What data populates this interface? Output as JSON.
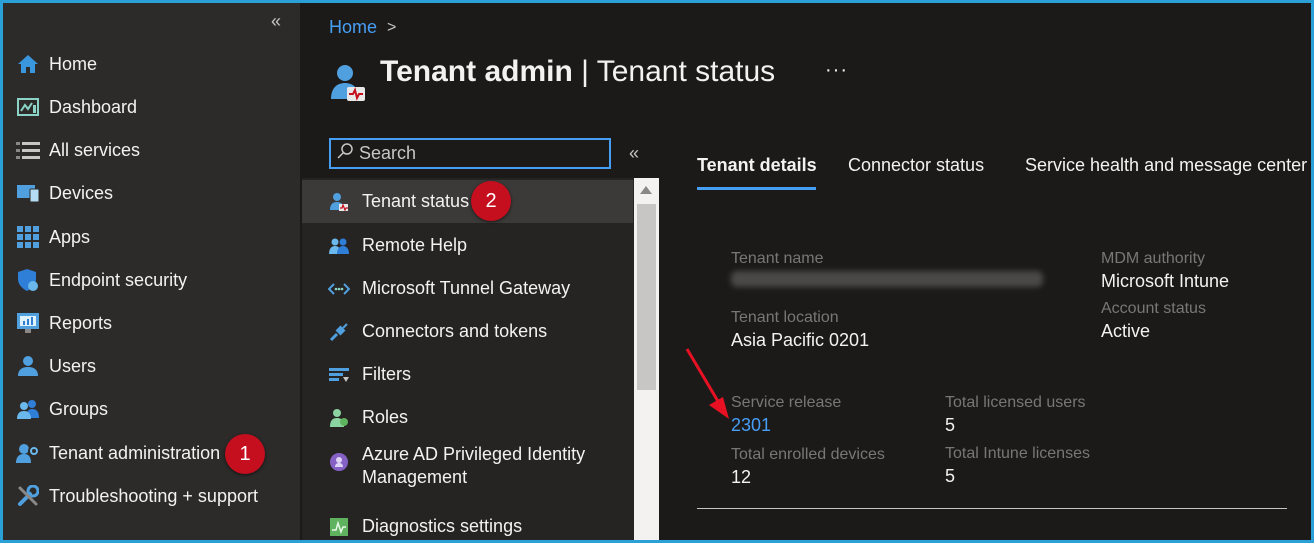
{
  "left_nav": {
    "collapse_label": "«",
    "items": [
      {
        "label": "Home",
        "icon": "home-icon"
      },
      {
        "label": "Dashboard",
        "icon": "dashboard-icon"
      },
      {
        "label": "All services",
        "icon": "list-icon"
      },
      {
        "label": "Devices",
        "icon": "devices-icon"
      },
      {
        "label": "Apps",
        "icon": "apps-grid-icon"
      },
      {
        "label": "Endpoint security",
        "icon": "shield-icon"
      },
      {
        "label": "Reports",
        "icon": "reports-icon"
      },
      {
        "label": "Users",
        "icon": "user-icon"
      },
      {
        "label": "Groups",
        "icon": "groups-icon"
      },
      {
        "label": "Tenant administration",
        "icon": "tenant-admin-icon"
      },
      {
        "label": "Troubleshooting + support",
        "icon": "wrench-icon"
      }
    ]
  },
  "annotations": {
    "one": "1",
    "two": "2"
  },
  "breadcrumb": {
    "home": "Home",
    "sep": ">"
  },
  "header": {
    "title_bold": "Tenant admin",
    "title_rest": " | Tenant status",
    "more": "···"
  },
  "search": {
    "placeholder": "Search"
  },
  "menu": {
    "collapse_label": "«",
    "items": [
      {
        "label": "Tenant status",
        "icon": "tenant-status-icon",
        "selected": true
      },
      {
        "label": "Remote Help",
        "icon": "remote-help-icon"
      },
      {
        "label": "Microsoft Tunnel Gateway",
        "icon": "tunnel-icon"
      },
      {
        "label": "Connectors and tokens",
        "icon": "connector-icon"
      },
      {
        "label": "Filters",
        "icon": "filter-icon"
      },
      {
        "label": "Roles",
        "icon": "roles-icon"
      },
      {
        "label": "Azure AD Privileged Identity Management",
        "icon": "pim-icon"
      },
      {
        "label": "Diagnostics settings",
        "icon": "diagnostics-icon"
      }
    ]
  },
  "tabs": [
    {
      "label": "Tenant details",
      "active": true
    },
    {
      "label": "Connector status"
    },
    {
      "label": "Service health and message center"
    }
  ],
  "details": {
    "tenant_name_label": "Tenant name",
    "tenant_location_label": "Tenant location",
    "tenant_location": "Asia Pacific 0201",
    "mdm_authority_label": "MDM authority",
    "mdm_authority": "Microsoft Intune",
    "account_status_label": "Account status",
    "account_status": "Active",
    "service_release_label": "Service release",
    "service_release": "2301",
    "total_licensed_users_label": "Total licensed users",
    "total_licensed_users": "5",
    "total_enrolled_devices_label": "Total enrolled devices",
    "total_enrolled_devices": "12",
    "total_intune_licenses_label": "Total Intune licenses",
    "total_intune_licenses": "5"
  },
  "colors": {
    "accent": "#479ef5",
    "annotation": "#c50f1f",
    "border": "#2aa0d6"
  }
}
